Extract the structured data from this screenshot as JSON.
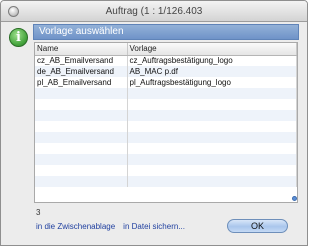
{
  "window": {
    "title": "Auftrag (1 : 1/126.403"
  },
  "dialog": {
    "header": "Vorlage auswählen",
    "icon": "info-icon"
  },
  "table": {
    "columns": [
      "Name",
      "Vorlage"
    ],
    "rows": [
      [
        "cz_AB_Emailversand",
        "cz_Auftragsbestätigung_logo"
      ],
      [
        "de_AB_Emailversand",
        "AB_MAC p.df"
      ],
      [
        "pl_AB_Emailversand",
        "pl_Auftragsbestätigung_logo"
      ],
      [
        "",
        ""
      ],
      [
        "",
        ""
      ],
      [
        "",
        ""
      ],
      [
        "",
        ""
      ],
      [
        "",
        ""
      ],
      [
        "",
        ""
      ],
      [
        "",
        ""
      ],
      [
        "",
        ""
      ],
      [
        "",
        ""
      ]
    ]
  },
  "footer": {
    "count": "3",
    "link_clipboard": "in die Zwischenablage",
    "link_file": "in Datei sichern...",
    "ok_label": "OK"
  },
  "colors": {
    "header_bar": "#7a9bd0",
    "info_icon": "#45a43d",
    "ok_button": "#a9c6ec"
  }
}
